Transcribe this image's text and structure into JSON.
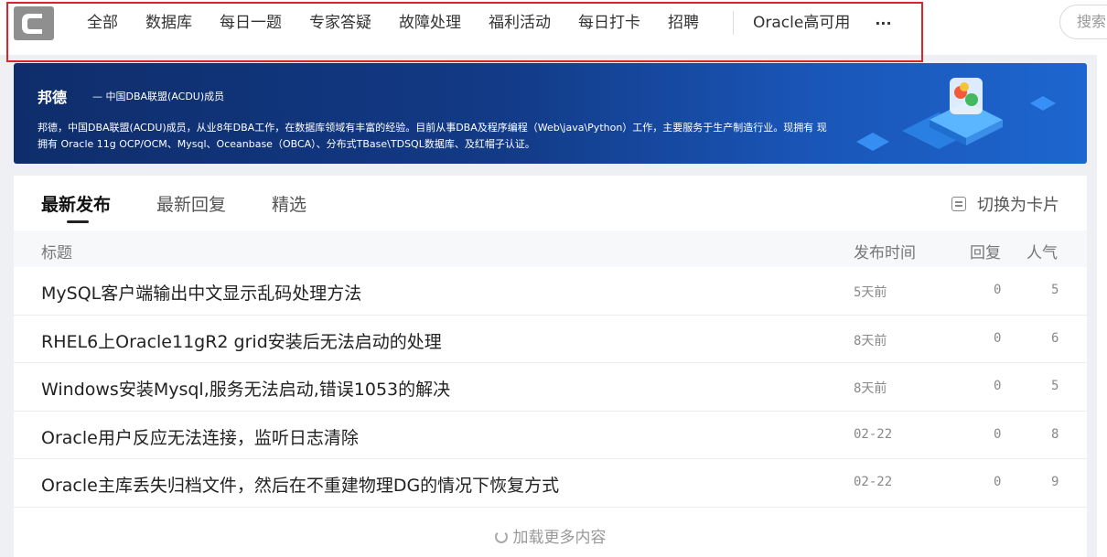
{
  "nav": {
    "items": [
      "全部",
      "数据库",
      "每日一题",
      "专家答疑",
      "故障处理",
      "福利活动",
      "每日打卡",
      "招聘"
    ],
    "extra": "Oracle高可用",
    "more": "···"
  },
  "search": {
    "placeholder": "搜索"
  },
  "banner": {
    "name": "邦德",
    "subtitle": "— 中国DBA联盟(ACDU)成员",
    "description": "邦德，中国DBA联盟(ACDU)成员，从业8年DBA工作，在数据库领域有丰富的经验。目前从事DBA及程序编程（Web\\java\\Python）工作，主要服务于生产制造行业。现拥有 现拥有 Oracle 11g OCP/OCM、Mysql、Oceanbase（OBCA）、分布式TBase\\TDSQL数据库、及红帽子认证。"
  },
  "tabs": [
    "最新发布",
    "最新回复",
    "精选"
  ],
  "switch_label": "切换为卡片",
  "table": {
    "headers": {
      "title": "标题",
      "time": "发布时间",
      "reply": "回复",
      "popularity": "人气"
    },
    "rows": [
      {
        "title": "MySQL客户端输出中文显示乱码处理方法",
        "time": "5天前",
        "reply": "0",
        "popularity": "5"
      },
      {
        "title": "RHEL6上Oracle11gR2 grid安装后无法启动的处理",
        "time": "8天前",
        "reply": "0",
        "popularity": "6"
      },
      {
        "title": "Windows安装Mysql,服务无法启动,错误1053的解决",
        "time": "8天前",
        "reply": "0",
        "popularity": "5"
      },
      {
        "title": "Oracle用户反应无法连接，监听日志清除",
        "time": "02-22",
        "reply": "0",
        "popularity": "8"
      },
      {
        "title": "Oracle主库丢失归档文件，然后在不重建物理DG的情况下恢复方式",
        "time": "02-22",
        "reply": "0",
        "popularity": "9"
      }
    ]
  },
  "load_more": "加载更多内容",
  "colors": {
    "highlight": "#d7262d",
    "banner": "#123a86"
  },
  "icons": {
    "logo": "c-logo-icon",
    "switch": "card-switch-icon",
    "load": "refresh-icon"
  }
}
